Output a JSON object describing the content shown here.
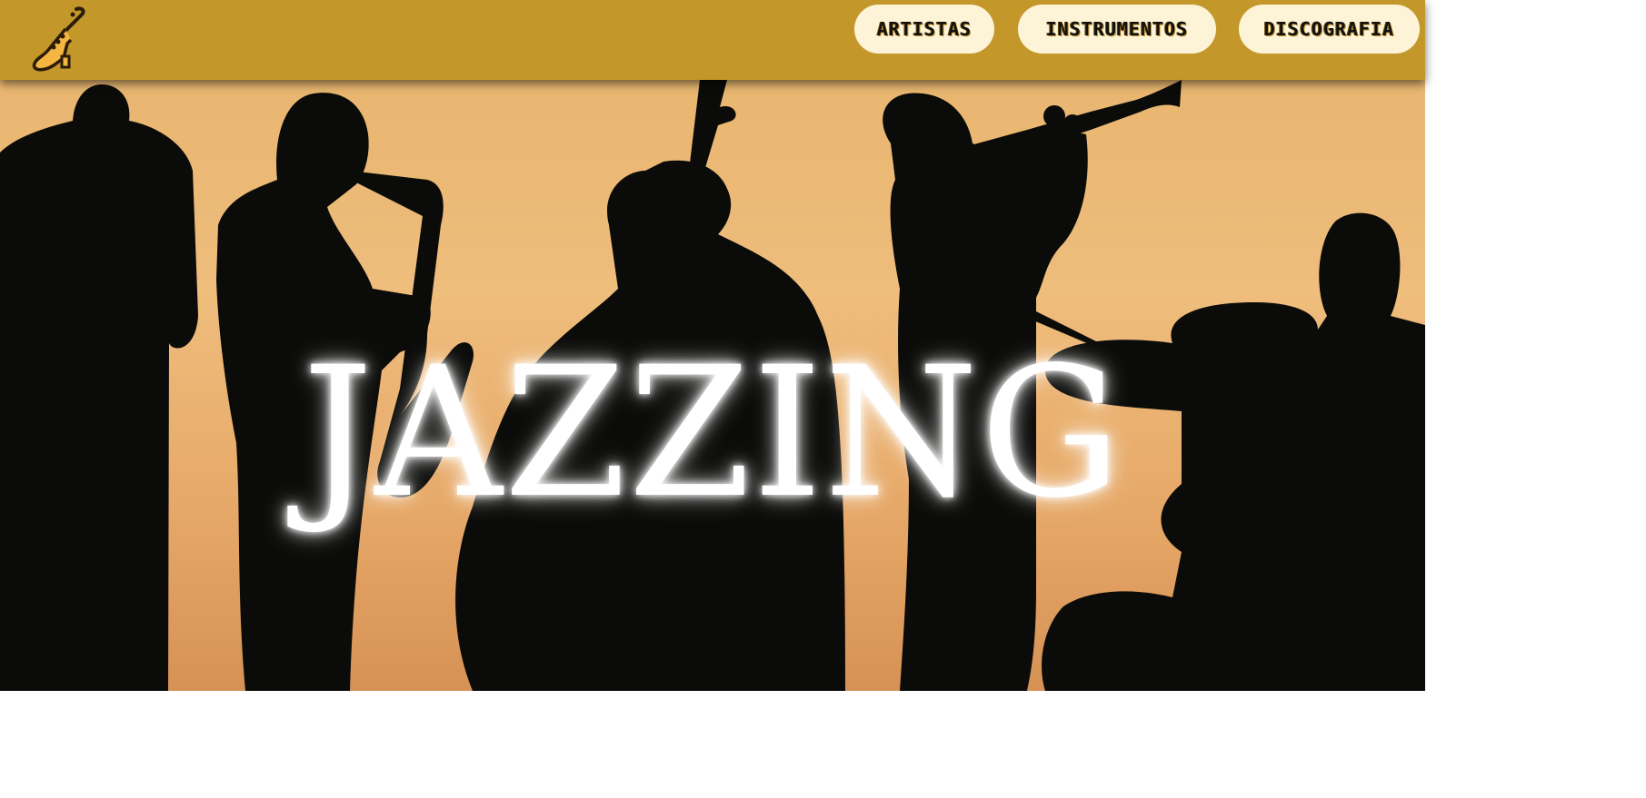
{
  "header": {
    "logo_icon": "saxophone-icon",
    "nav": [
      {
        "label": "ARTISTAS"
      },
      {
        "label": "INSTRUMENTOS"
      },
      {
        "label": "DISCOGRAFIA"
      }
    ],
    "colors": {
      "bar": "#c4972b",
      "button": "#fdf3d6"
    }
  },
  "hero": {
    "title": "JAZZING",
    "image": "jazz-band-silhouette-image"
  }
}
